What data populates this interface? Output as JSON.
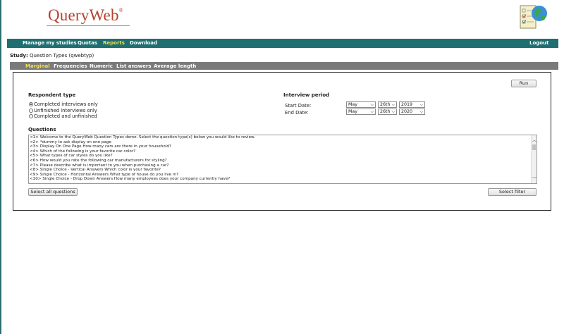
{
  "brand": {
    "logo_text": "QueryWeb",
    "logo_mark": "®"
  },
  "nav": {
    "items": [
      "Manage my studies",
      "Quotas",
      "Reports",
      "Download"
    ],
    "active": "Reports",
    "logout": "Logout"
  },
  "study": {
    "label": "Study:",
    "value": "Question Types (qwebtyp)"
  },
  "subnav": {
    "items": [
      "Marginal",
      "Frequencies",
      "Numeric",
      "List answers",
      "Average length"
    ],
    "active": "Marginal"
  },
  "panel": {
    "run_label": "Run",
    "respondent": {
      "title": "Respondent type",
      "options": [
        "Completed interviews only",
        "Unfinished interviews only",
        "Completed and unfinished"
      ],
      "selected_index": 0
    },
    "period": {
      "title": "Interview period",
      "start_label": "Start Date:",
      "end_label": "End Date:",
      "start": {
        "month": "May",
        "day": "26th",
        "year": "2019"
      },
      "end": {
        "month": "May",
        "day": "26th",
        "year": "2020"
      }
    },
    "questions": {
      "title": "Questions",
      "items": [
        "<1> Welcome to the QueryWeb Question Types demo. Select the question type(s) below you would like to review.",
        "<2> *dummy to ask display on one page",
        "<3> Display On One Page How many cars are there in your household?",
        "<4> Which of the following is your favorite car color?",
        "<5> What types of car styles do you like?",
        "<6> How would you rate the following car manufacturers for styling?",
        "<7> Please describe what is important to you when purchasing a car?",
        "<8> Single Choice - Vertical Answers Which color is your favorite?",
        "<9> Single Choice - Horizontal Answers What type of house do you live in?",
        "<10> Single Choice - Drop Down Answers How many employees does your company currently have?"
      ]
    },
    "select_all_label": "Select all questions",
    "select_filter_label": "Select filter"
  },
  "colors": {
    "nav_bg": "#1e6e72",
    "nav_active": "#f5e34a",
    "subnav_bg": "#7a7a7a",
    "logo": "#b5412b"
  },
  "icons": {
    "header_logo": "checklist-globe-icon",
    "dropdown": "chevron-down-icon"
  }
}
